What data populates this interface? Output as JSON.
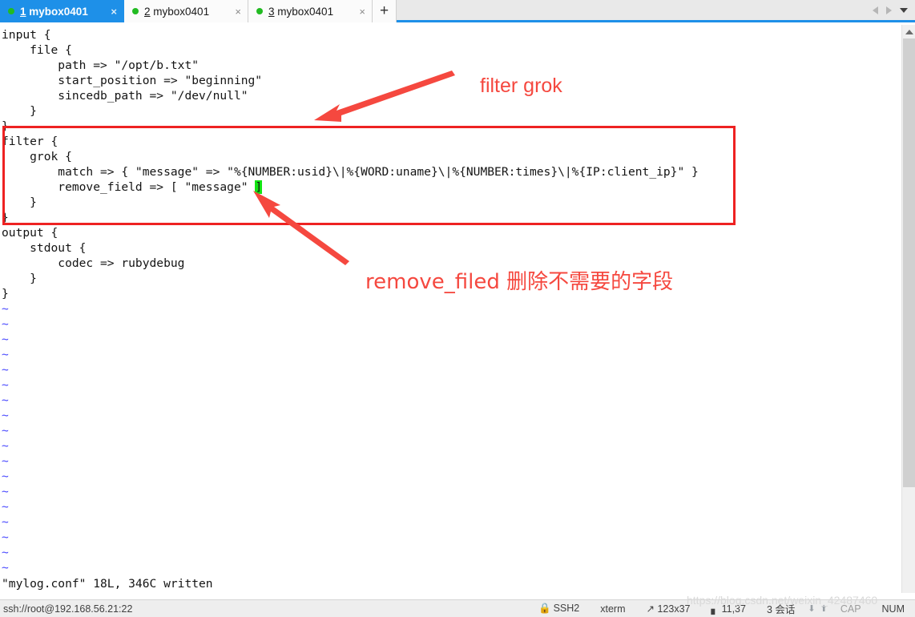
{
  "tabbar": {
    "tabs": [
      {
        "num": "1",
        "name": "mybox0401",
        "active": true,
        "status_dot": "green-dot-icon",
        "close": "×"
      },
      {
        "num": "2",
        "name": "mybox0401",
        "active": false,
        "status_dot": "green-dot-icon",
        "close": "×"
      },
      {
        "num": "3",
        "name": "mybox0401",
        "active": false,
        "status_dot": "green-dot-icon",
        "close": "×"
      }
    ],
    "add_tab_label": "+",
    "scroll_left_icon": "triangle-left-icon",
    "scroll_right_icon": "triangle-right-icon",
    "tab_menu_icon": "chevron-down-icon",
    "accent_color": "#1e90e8"
  },
  "terminal": {
    "lines": [
      "input {",
      "    file {",
      "        path => \"/opt/b.txt\"",
      "        start_position => \"beginning\"",
      "        sincedb_path => \"/dev/null\"",
      "    }",
      "}",
      "filter {",
      "    grok {",
      "        match => { \"message\" => \"%{NUMBER:usid}\\|%{WORD:uname}\\|%{NUMBER:times}\\|%{IP:client_ip}\" }",
      "        remove_field => [ \"message\" ",
      "    }",
      "}",
      "output {",
      "    stdout {",
      "        codec => rubydebug",
      "    }",
      "}"
    ],
    "cursor_char": "]",
    "cursor_color": "#13e413",
    "empty_line_marker": "~",
    "empty_line_count": 18,
    "empty_line_color": "#4a4aff",
    "message_line": "\"mylog.conf\" 18L, 346C written"
  },
  "annotations": {
    "filter_grok": "filter grok",
    "remove_filed": "remove_filed 删除不需要的字段",
    "color": "#f5483f",
    "box_color": "#ee2222"
  },
  "statusbar": {
    "connection": "ssh://root@192.168.56.21:22",
    "protocol": "SSH2",
    "terminal_type": "xterm",
    "size": "123x37",
    "cursor_pos": "11,37",
    "sessions": "3 会话",
    "cap": "CAP",
    "num": "NUM",
    "lock_icon": "lock-icon",
    "size_icon": "resize-icon",
    "cursor_icon": "cursor-pos-icon",
    "up_icon": "arrow-up-icon",
    "down_icon": "arrow-down-icon"
  },
  "watermark": {
    "text": "https://blog.csdn.net/weixin_42487460"
  },
  "scrollbar": {
    "up_icon": "chevron-up-icon",
    "down_icon": "chevron-down-icon"
  }
}
